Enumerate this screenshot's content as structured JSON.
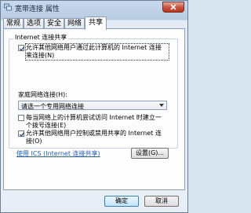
{
  "window": {
    "title": "宽带连接 属性"
  },
  "tabs": [
    {
      "label": "常规"
    },
    {
      "label": "选项"
    },
    {
      "label": "安全"
    },
    {
      "label": "网络"
    },
    {
      "label": "共享",
      "active": true
    }
  ],
  "sharing": {
    "group_title": "Internet 连接共享",
    "allow_share_line1": "允许其他网络用户通过此计算机的 Internet 连接",
    "allow_share_line2": "来连接(N)",
    "allow_share_checked": true,
    "home_network_label": "家庭网络连接(H):",
    "home_network_value": "请选一个专用网络连接",
    "dial_on_demand_line1": "每当网络上的计算机尝试访问 Internet 时建立一",
    "dial_on_demand_line2": "个拨号连接(E)",
    "dial_on_demand_checked": false,
    "allow_control_line1": "允许其他网络用户控制或禁用共享的 Internet 连",
    "allow_control_line2": "接(O)",
    "allow_control_checked": true,
    "ics_link": "使用 ICS (Internet 连接共享)",
    "settings_button": "设置(G)..."
  },
  "footer": {
    "ok": "确定",
    "cancel": "取消"
  }
}
